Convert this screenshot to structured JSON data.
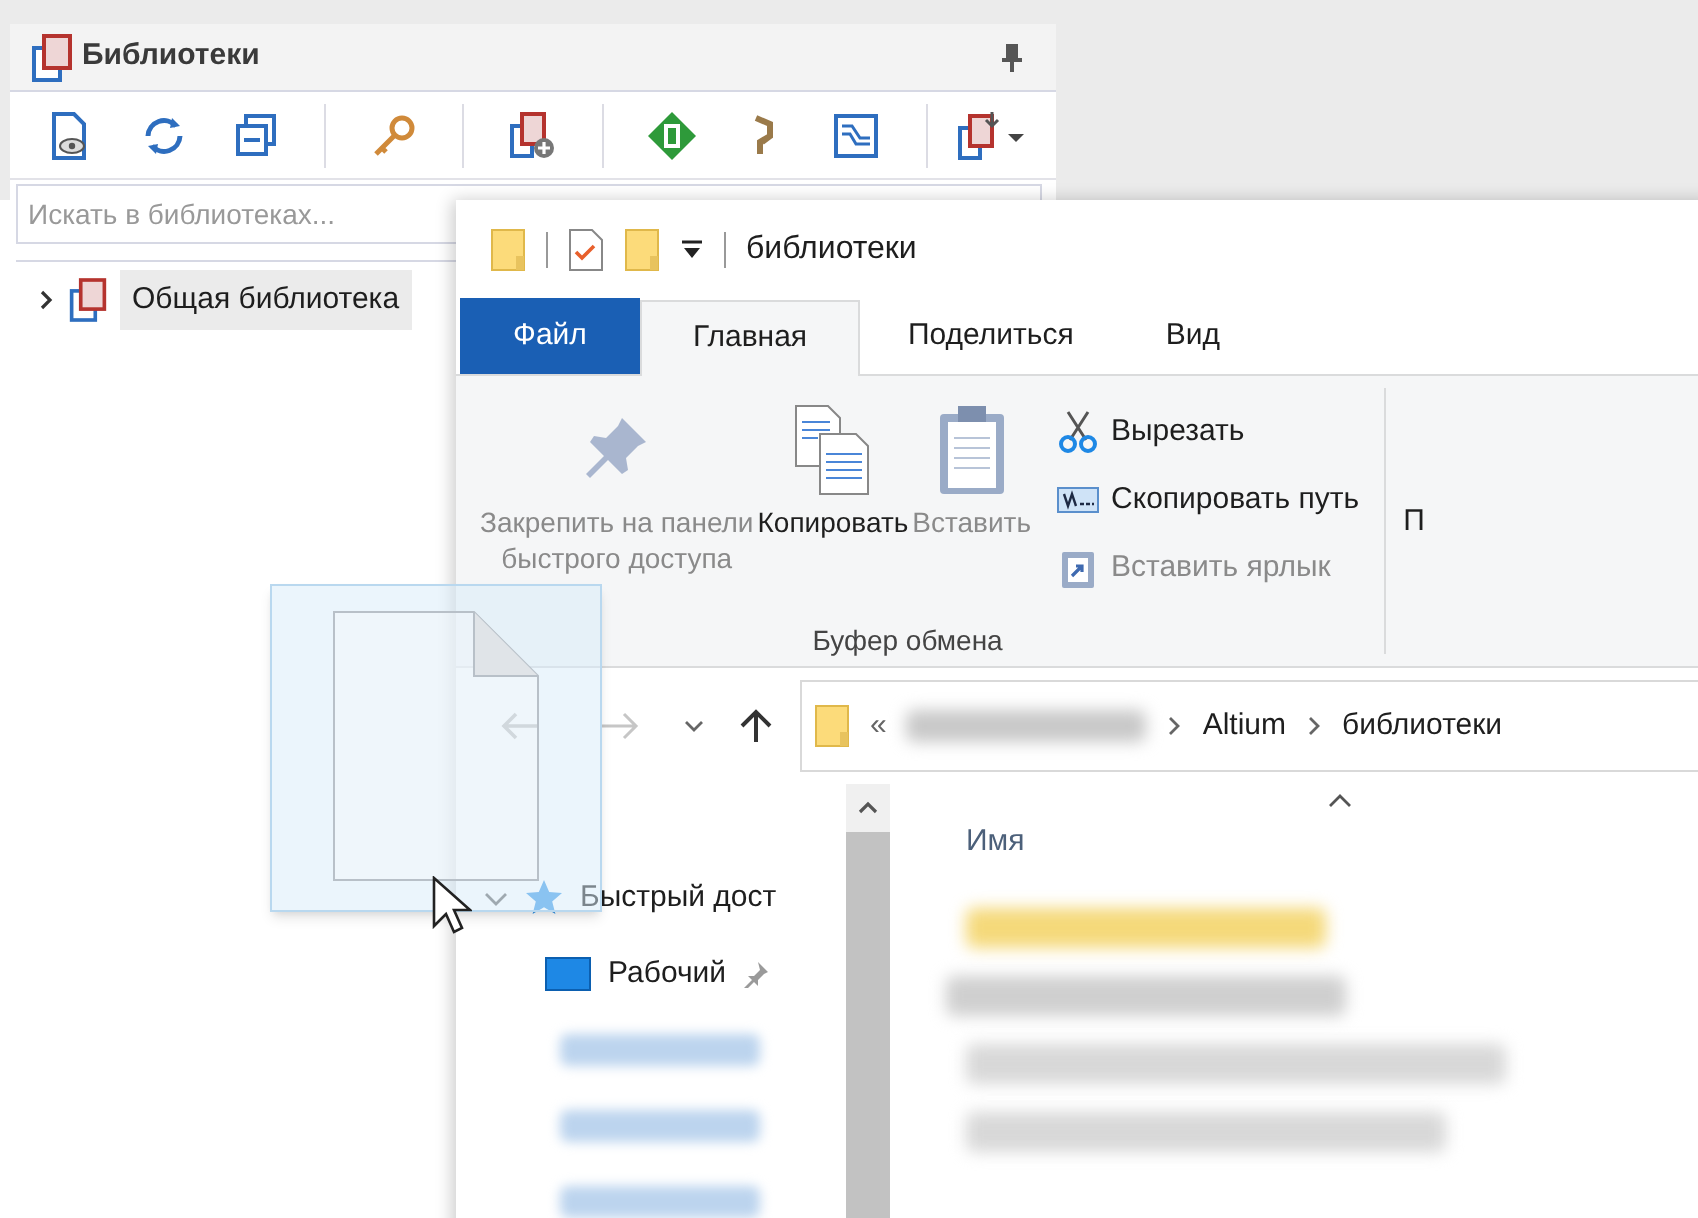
{
  "library_panel": {
    "title": "Библиотеки",
    "search": {
      "placeholder": "Искать в библиотеках..."
    },
    "tree": [
      {
        "label": "Общая библиотека",
        "expanded": false,
        "selected": true
      }
    ]
  },
  "explorer": {
    "title": "библиотеки",
    "tabs": [
      {
        "label": "Файл",
        "kind": "file",
        "selected": false
      },
      {
        "label": "Главная",
        "kind": "tab",
        "selected": true
      },
      {
        "label": "Поделиться",
        "kind": "tab",
        "selected": false
      },
      {
        "label": "Вид",
        "kind": "tab",
        "selected": false
      }
    ],
    "ribbon": {
      "group": "Буфер обмена",
      "large_buttons": [
        {
          "label": "Закрепить на панели\nбыстрого доступа",
          "disabled": true
        },
        {
          "label": "Копировать",
          "disabled": false
        },
        {
          "label": "Вставить",
          "disabled": true
        }
      ],
      "small_buttons": [
        {
          "label": "Вырезать",
          "disabled": false
        },
        {
          "label": "Скопировать путь",
          "disabled": false
        },
        {
          "label": "Вставить ярлык",
          "disabled": true
        }
      ],
      "next_group": "П"
    },
    "address": {
      "overflow": "«",
      "segments": [
        "Altium",
        "библиотеки"
      ]
    },
    "nav_pane": [
      {
        "label": "Быстрый дост",
        "kind": "quick",
        "expanded": true
      },
      {
        "label": "Рабочий",
        "kind": "desktop",
        "pinned": true
      }
    ],
    "columns": [
      {
        "label": "Имя"
      }
    ]
  }
}
